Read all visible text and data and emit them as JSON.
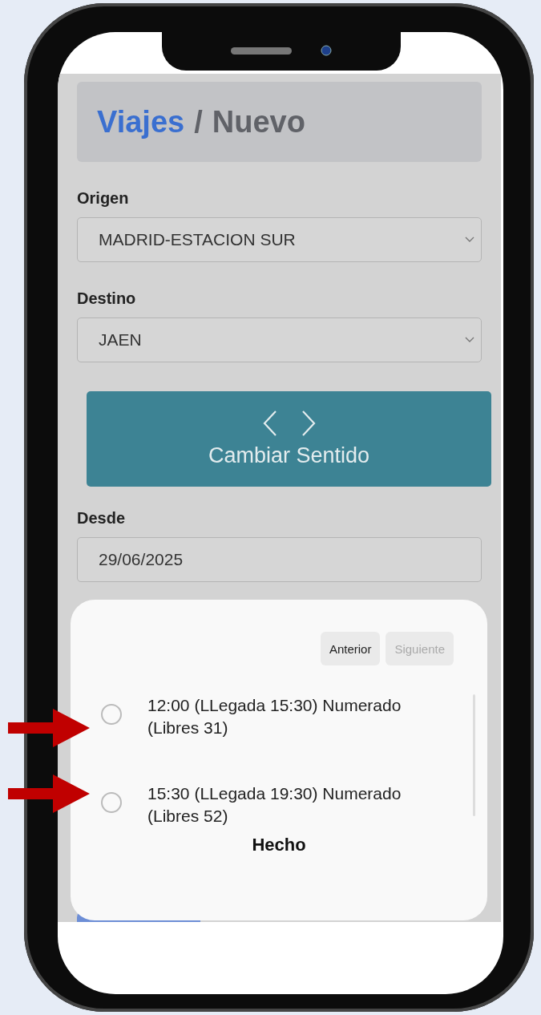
{
  "header": {
    "breadcrumb_link": "Viajes",
    "separator": "/",
    "current": "Nuevo"
  },
  "fields": [
    {
      "label": "Origen",
      "value": "MADRID-ESTACION SUR",
      "kind": "select"
    },
    {
      "label": "Destino",
      "value": "JAEN",
      "kind": "select"
    }
  ],
  "swap_button": {
    "label": "Cambiar Sentido"
  },
  "date_field": {
    "label": "Desde",
    "value": "29/06/2025"
  },
  "sheet": {
    "pager": [
      {
        "label": "Anterior",
        "disabled": false
      },
      {
        "label": "Siguiente",
        "disabled": true
      }
    ],
    "options": [
      {
        "label": "12:00 (LLegada 15:30) Numerado (Libres 31)",
        "selected": false,
        "pointed": true
      },
      {
        "label": "15:30 (LLegada 19:30) Numerado (Libres 52)",
        "selected": false,
        "pointed": true
      }
    ],
    "done_button": "Hecho"
  }
}
